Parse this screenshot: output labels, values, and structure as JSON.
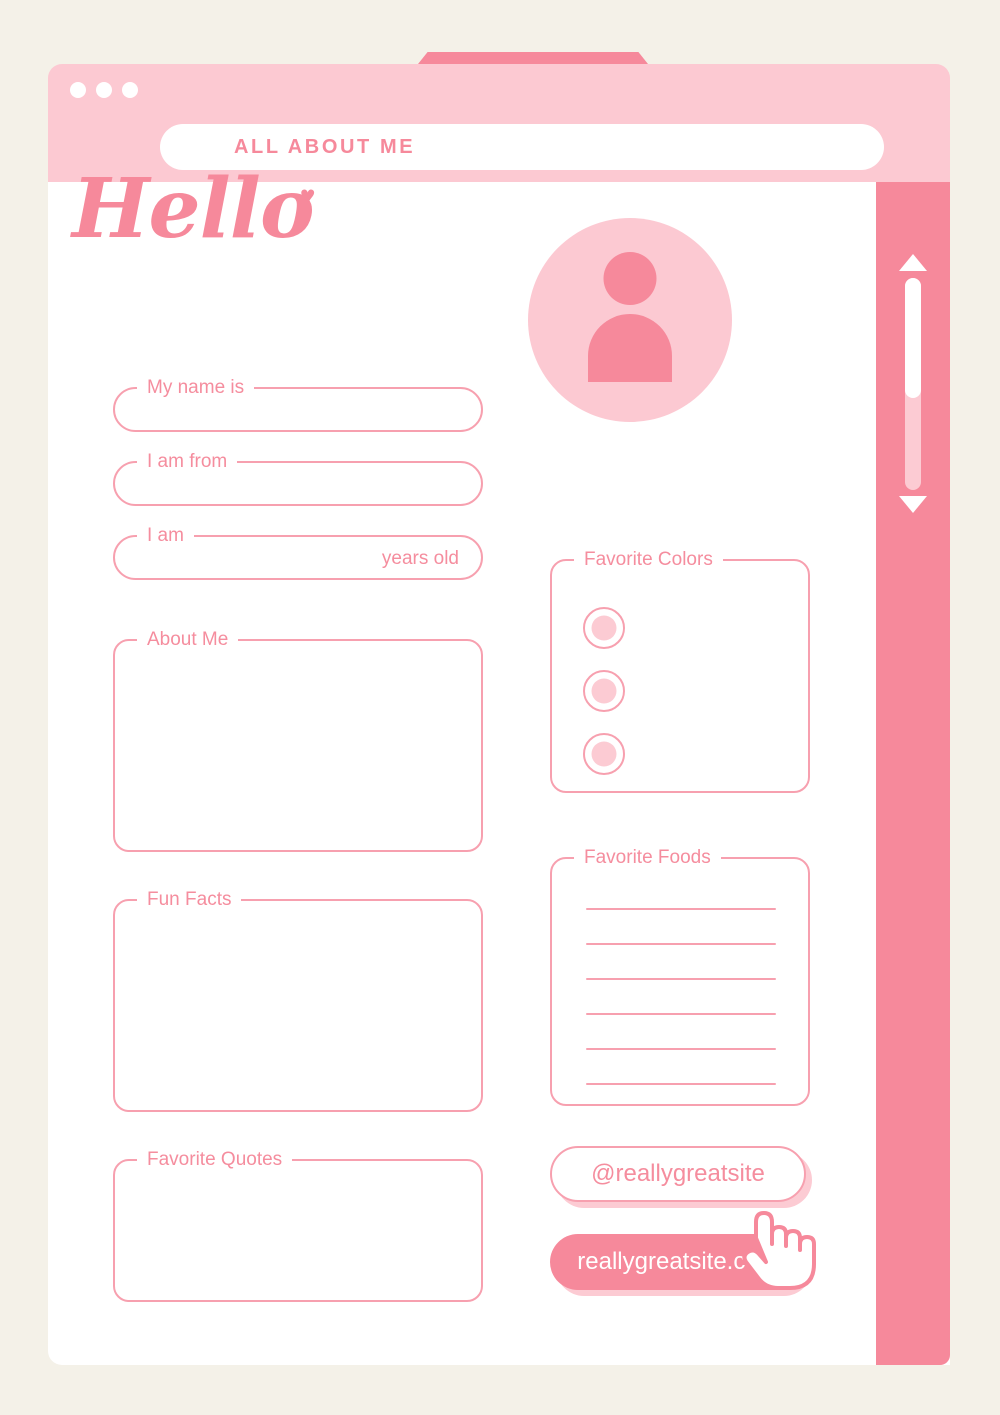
{
  "page": {
    "background_color": "#F4F1E8",
    "accent_color": "#F6899B",
    "light_accent_color": "#FCCBD3",
    "outline_color": "#F7A0AF"
  },
  "browser": {
    "title_bar": {
      "dots": [
        "window-dot-1",
        "window-dot-2",
        "window-dot-3"
      ],
      "tab_label": ""
    },
    "address_bar": {
      "value": "ALL ABOUT ME",
      "placeholder": "ALL ABOUT ME"
    },
    "scrollbar": {
      "up_arrow": "scroll-up-arrow",
      "down_arrow": "scroll-down-arrow",
      "thumb_percent": 57
    }
  },
  "heading": {
    "text": "Hello",
    "heart_icon": "♥"
  },
  "avatar": {
    "icon": "person-icon"
  },
  "left_column": {
    "fields": [
      {
        "label": "My name is",
        "value": "",
        "placeholder": "",
        "suffix": ""
      },
      {
        "label": "I am from",
        "value": "",
        "placeholder": "",
        "suffix": ""
      },
      {
        "label": "I am",
        "value": "",
        "placeholder": "",
        "suffix": "years old"
      }
    ],
    "textareas": [
      {
        "label": "About Me",
        "value": "",
        "placeholder": ""
      },
      {
        "label": "Fun Facts",
        "value": "",
        "placeholder": ""
      },
      {
        "label": "Favorite Quotes",
        "value": "",
        "placeholder": ""
      }
    ]
  },
  "right_column": {
    "favorite_colors": {
      "label": "Favorite Colors",
      "swatches": [
        {
          "name": "color-swatch-1",
          "color": "#FCCBD3"
        },
        {
          "name": "color-swatch-2",
          "color": "#FCCBD3"
        },
        {
          "name": "color-swatch-3",
          "color": "#FCCBD3"
        }
      ]
    },
    "favorite_foods": {
      "label": "Favorite Foods",
      "lines": [
        "",
        "",
        "",
        "",
        "",
        ""
      ]
    },
    "social_handle": "@reallygreatsite",
    "website": "reallygreatsite.com"
  }
}
